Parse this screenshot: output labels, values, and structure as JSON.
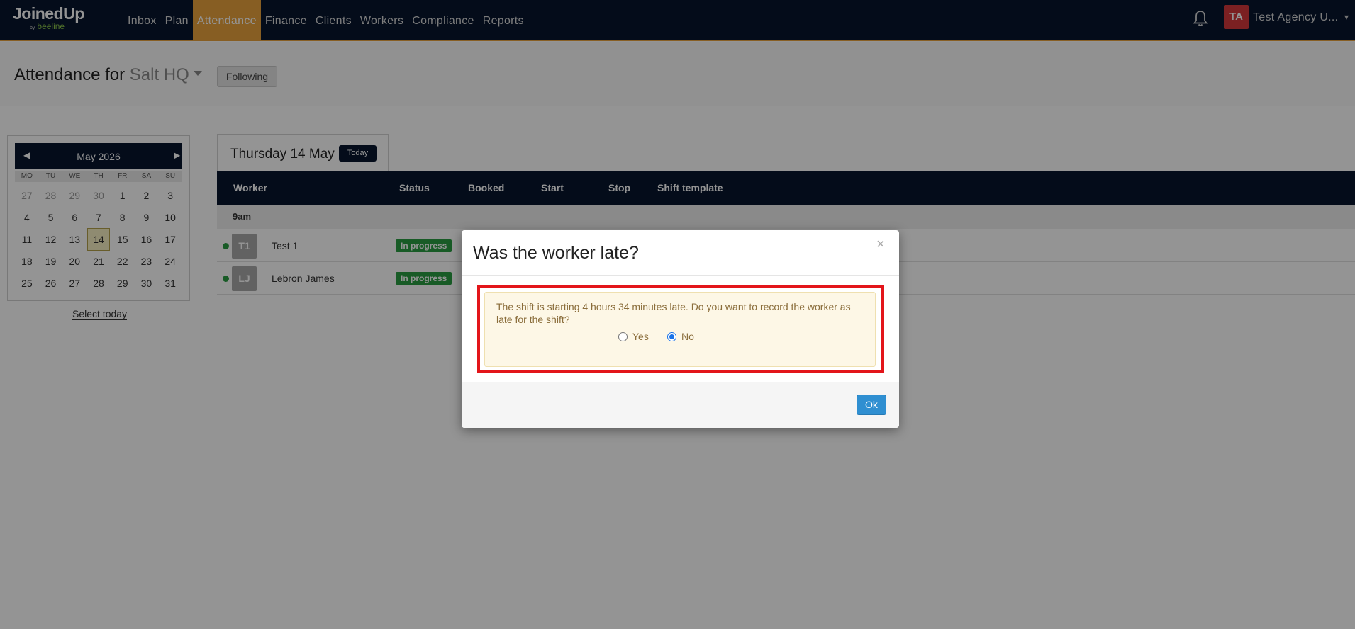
{
  "nav": {
    "logo_main": "JoinedUp",
    "logo_by": "by",
    "logo_sub": "beeline",
    "items": [
      {
        "label": "Inbox",
        "active": false
      },
      {
        "label": "Plan",
        "active": false
      },
      {
        "label": "Attendance",
        "active": true
      },
      {
        "label": "Finance",
        "active": false
      },
      {
        "label": "Clients",
        "active": false
      },
      {
        "label": "Workers",
        "active": false
      },
      {
        "label": "Compliance",
        "active": false
      },
      {
        "label": "Reports",
        "active": false
      }
    ],
    "user_initials": "TA",
    "user_name": "Test Agency U...",
    "accent": "#e8a33d",
    "bg": "#08162e"
  },
  "header": {
    "title_prefix": "Attendance for",
    "location": "Salt HQ",
    "following_label": "Following"
  },
  "calendar": {
    "month_label": "May 2026",
    "dow": [
      "MO",
      "TU",
      "WE",
      "TH",
      "FR",
      "SA",
      "SU"
    ],
    "days": [
      {
        "d": "27",
        "muted": true
      },
      {
        "d": "28",
        "muted": true
      },
      {
        "d": "29",
        "muted": true
      },
      {
        "d": "30",
        "muted": true
      },
      {
        "d": "1"
      },
      {
        "d": "2"
      },
      {
        "d": "3"
      },
      {
        "d": "4"
      },
      {
        "d": "5"
      },
      {
        "d": "6"
      },
      {
        "d": "7"
      },
      {
        "d": "8"
      },
      {
        "d": "9"
      },
      {
        "d": "10"
      },
      {
        "d": "11"
      },
      {
        "d": "12"
      },
      {
        "d": "13"
      },
      {
        "d": "14",
        "today": true
      },
      {
        "d": "15"
      },
      {
        "d": "16"
      },
      {
        "d": "17"
      },
      {
        "d": "18"
      },
      {
        "d": "19"
      },
      {
        "d": "20"
      },
      {
        "d": "21"
      },
      {
        "d": "22"
      },
      {
        "d": "23"
      },
      {
        "d": "24"
      },
      {
        "d": "25"
      },
      {
        "d": "26"
      },
      {
        "d": "27"
      },
      {
        "d": "28"
      },
      {
        "d": "29"
      },
      {
        "d": "30"
      },
      {
        "d": "31"
      }
    ],
    "select_today_label": "Select today"
  },
  "date_panel": {
    "title": "Thursday 14 May",
    "today_label": "Today"
  },
  "table": {
    "columns": [
      "Worker",
      "Status",
      "Booked",
      "Start",
      "Stop",
      "Shift template"
    ],
    "group_label": "9am",
    "rows": [
      {
        "initials": "T1",
        "name": "Test 1",
        "status": "In progress"
      },
      {
        "initials": "LJ",
        "name": "Lebron James",
        "status": "In progress"
      }
    ]
  },
  "modal": {
    "title": "Was the worker late?",
    "close_glyph": "×",
    "message": "The shift is starting 4 hours 34 minutes late. Do you want to record the worker as late for the shift?",
    "options": [
      {
        "label": "Yes",
        "checked": false
      },
      {
        "label": "No",
        "checked": true
      }
    ],
    "ok_label": "Ok"
  }
}
